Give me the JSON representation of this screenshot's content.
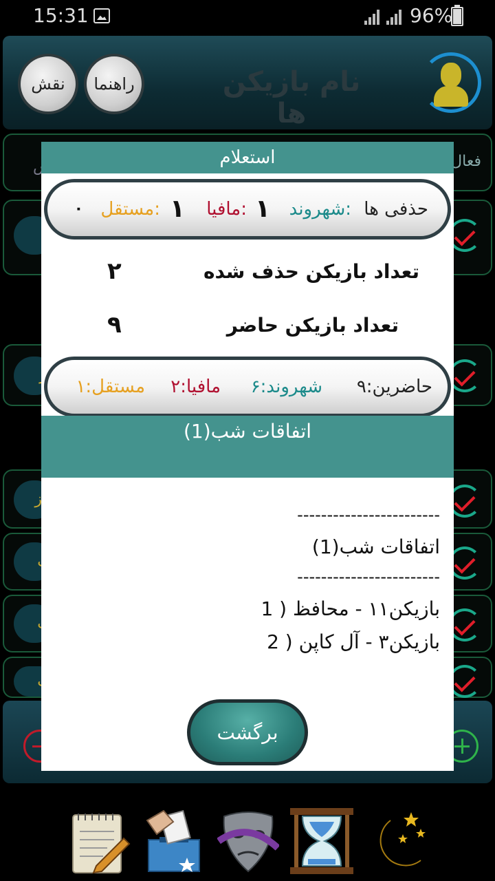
{
  "status_bar": {
    "time": "15:31",
    "battery": "96%"
  },
  "header": {
    "title": "نام بازیکن ها",
    "guide_button": "راهنما",
    "role_button": "نقش"
  },
  "background": {
    "active_label": "فعال",
    "visible_pill_texts": [
      "د",
      "ار",
      "باز",
      "ک",
      "ک",
      "ک"
    ]
  },
  "dialog": {
    "title": "استعلام",
    "removed_summary": {
      "label": "حذفی ها",
      "citizen_label": "شهروند:",
      "citizen_value": "۱",
      "mafia_label": "مافیا:",
      "mafia_value": "۱",
      "independent_label": "مستقل:",
      "independent_value": "۰"
    },
    "removed_count_label": "تعداد بازیکن حذف شده",
    "removed_count_value": "۲",
    "present_count_label": "تعداد بازیکن حاضر",
    "present_count_value": "۹",
    "present_summary": {
      "present": "حاضرین:۹",
      "citizen": "شهروند:۶",
      "mafia": "مافیا:۲",
      "independent": "مستقل:۱"
    },
    "events_title": "اتفاقات شب(1)",
    "log": {
      "separator": "------------------------",
      "heading": "اتفاقات شب(1)",
      "lines": [
        "1 )  بازیکن۱۱ - محافظ",
        "2 )  بازیکن۳ - آل کاپن"
      ]
    },
    "back_button": "برگشت"
  },
  "colors": {
    "teal": "#44938e",
    "citizen": "#1b8a8a",
    "mafia": "#b01030",
    "independent": "#e6a020"
  },
  "bottom_tabs": [
    "notes-icon",
    "vote-icon",
    "masks-icon",
    "hourglass-icon",
    "night-icon"
  ]
}
